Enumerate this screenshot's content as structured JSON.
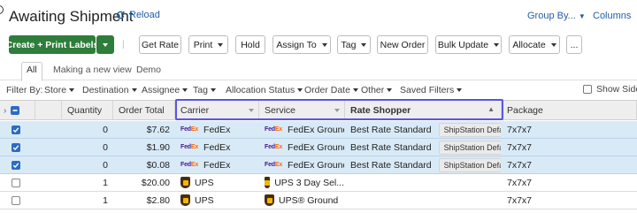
{
  "header": {
    "title": "Awaiting Shipment",
    "reload_label": "Reload",
    "group_by_label": "Group By...",
    "columns_label": "Columns"
  },
  "toolbar": {
    "create_print": "Create + Print Labels",
    "get_rate": "Get Rate",
    "print": "Print",
    "hold": "Hold",
    "assign_to": "Assign To",
    "tag": "Tag",
    "new_order": "New Order",
    "bulk_update": "Bulk Update",
    "allocate": "Allocate",
    "more": "...",
    "separator": "|"
  },
  "tabs": [
    "All",
    "Making a new view",
    "Demo"
  ],
  "filters": {
    "label": "Filter By:",
    "items": [
      "Store",
      "Destination",
      "Assignee",
      "Tag",
      "Allocation Status",
      "Order Date",
      "Other",
      "Saved Filters"
    ],
    "show_sidebar": "Show Sidebar"
  },
  "grid": {
    "columns": [
      "Quantity",
      "Order Total",
      "Carrier",
      "Service",
      "Rate Shopper",
      "Package"
    ],
    "rows": [
      {
        "selected": true,
        "quantity": "0",
        "total": "$7.62",
        "carrier": "FedEx",
        "carrier_icon": "fedex-logo-icon",
        "service": "FedEx Ground...",
        "rate_shopper": "Best Rate Standard",
        "badge": "ShipStation Default",
        "package": "7x7x7"
      },
      {
        "selected": true,
        "quantity": "0",
        "total": "$1.90",
        "carrier": "FedEx",
        "carrier_icon": "fedex-logo-icon",
        "service": "FedEx Ground...",
        "rate_shopper": "Best Rate Standard",
        "badge": "ShipStation Default",
        "package": "7x7x7"
      },
      {
        "selected": true,
        "quantity": "0",
        "total": "$0.08",
        "carrier": "FedEx",
        "carrier_icon": "fedex-logo-icon",
        "service": "FedEx Ground...",
        "rate_shopper": "Best Rate Standard",
        "badge": "ShipStation Default",
        "package": "7x7x7"
      },
      {
        "selected": false,
        "quantity": "1",
        "total": "$20.00",
        "carrier": "UPS",
        "carrier_icon": "ups-logo-icon",
        "service": "UPS 3 Day Sel...",
        "rate_shopper": "",
        "badge": "",
        "package": "7x7x7"
      },
      {
        "selected": false,
        "quantity": "1",
        "total": "$2.80",
        "carrier": "UPS",
        "carrier_icon": "ups-logo-icon",
        "service": "UPS® Ground",
        "rate_shopper": "",
        "badge": "",
        "package": "7x7x7"
      }
    ]
  },
  "logos": {
    "fedex_fe": "Fed",
    "fedex_ex": "Ex"
  },
  "colors": {
    "primary_green": "#2e7d3a",
    "link_blue": "#1f5fa8",
    "selected_row": "#d9eaf7",
    "highlight_frame": "#5b55e0",
    "checkbox_blue": "#2b6cc4"
  }
}
